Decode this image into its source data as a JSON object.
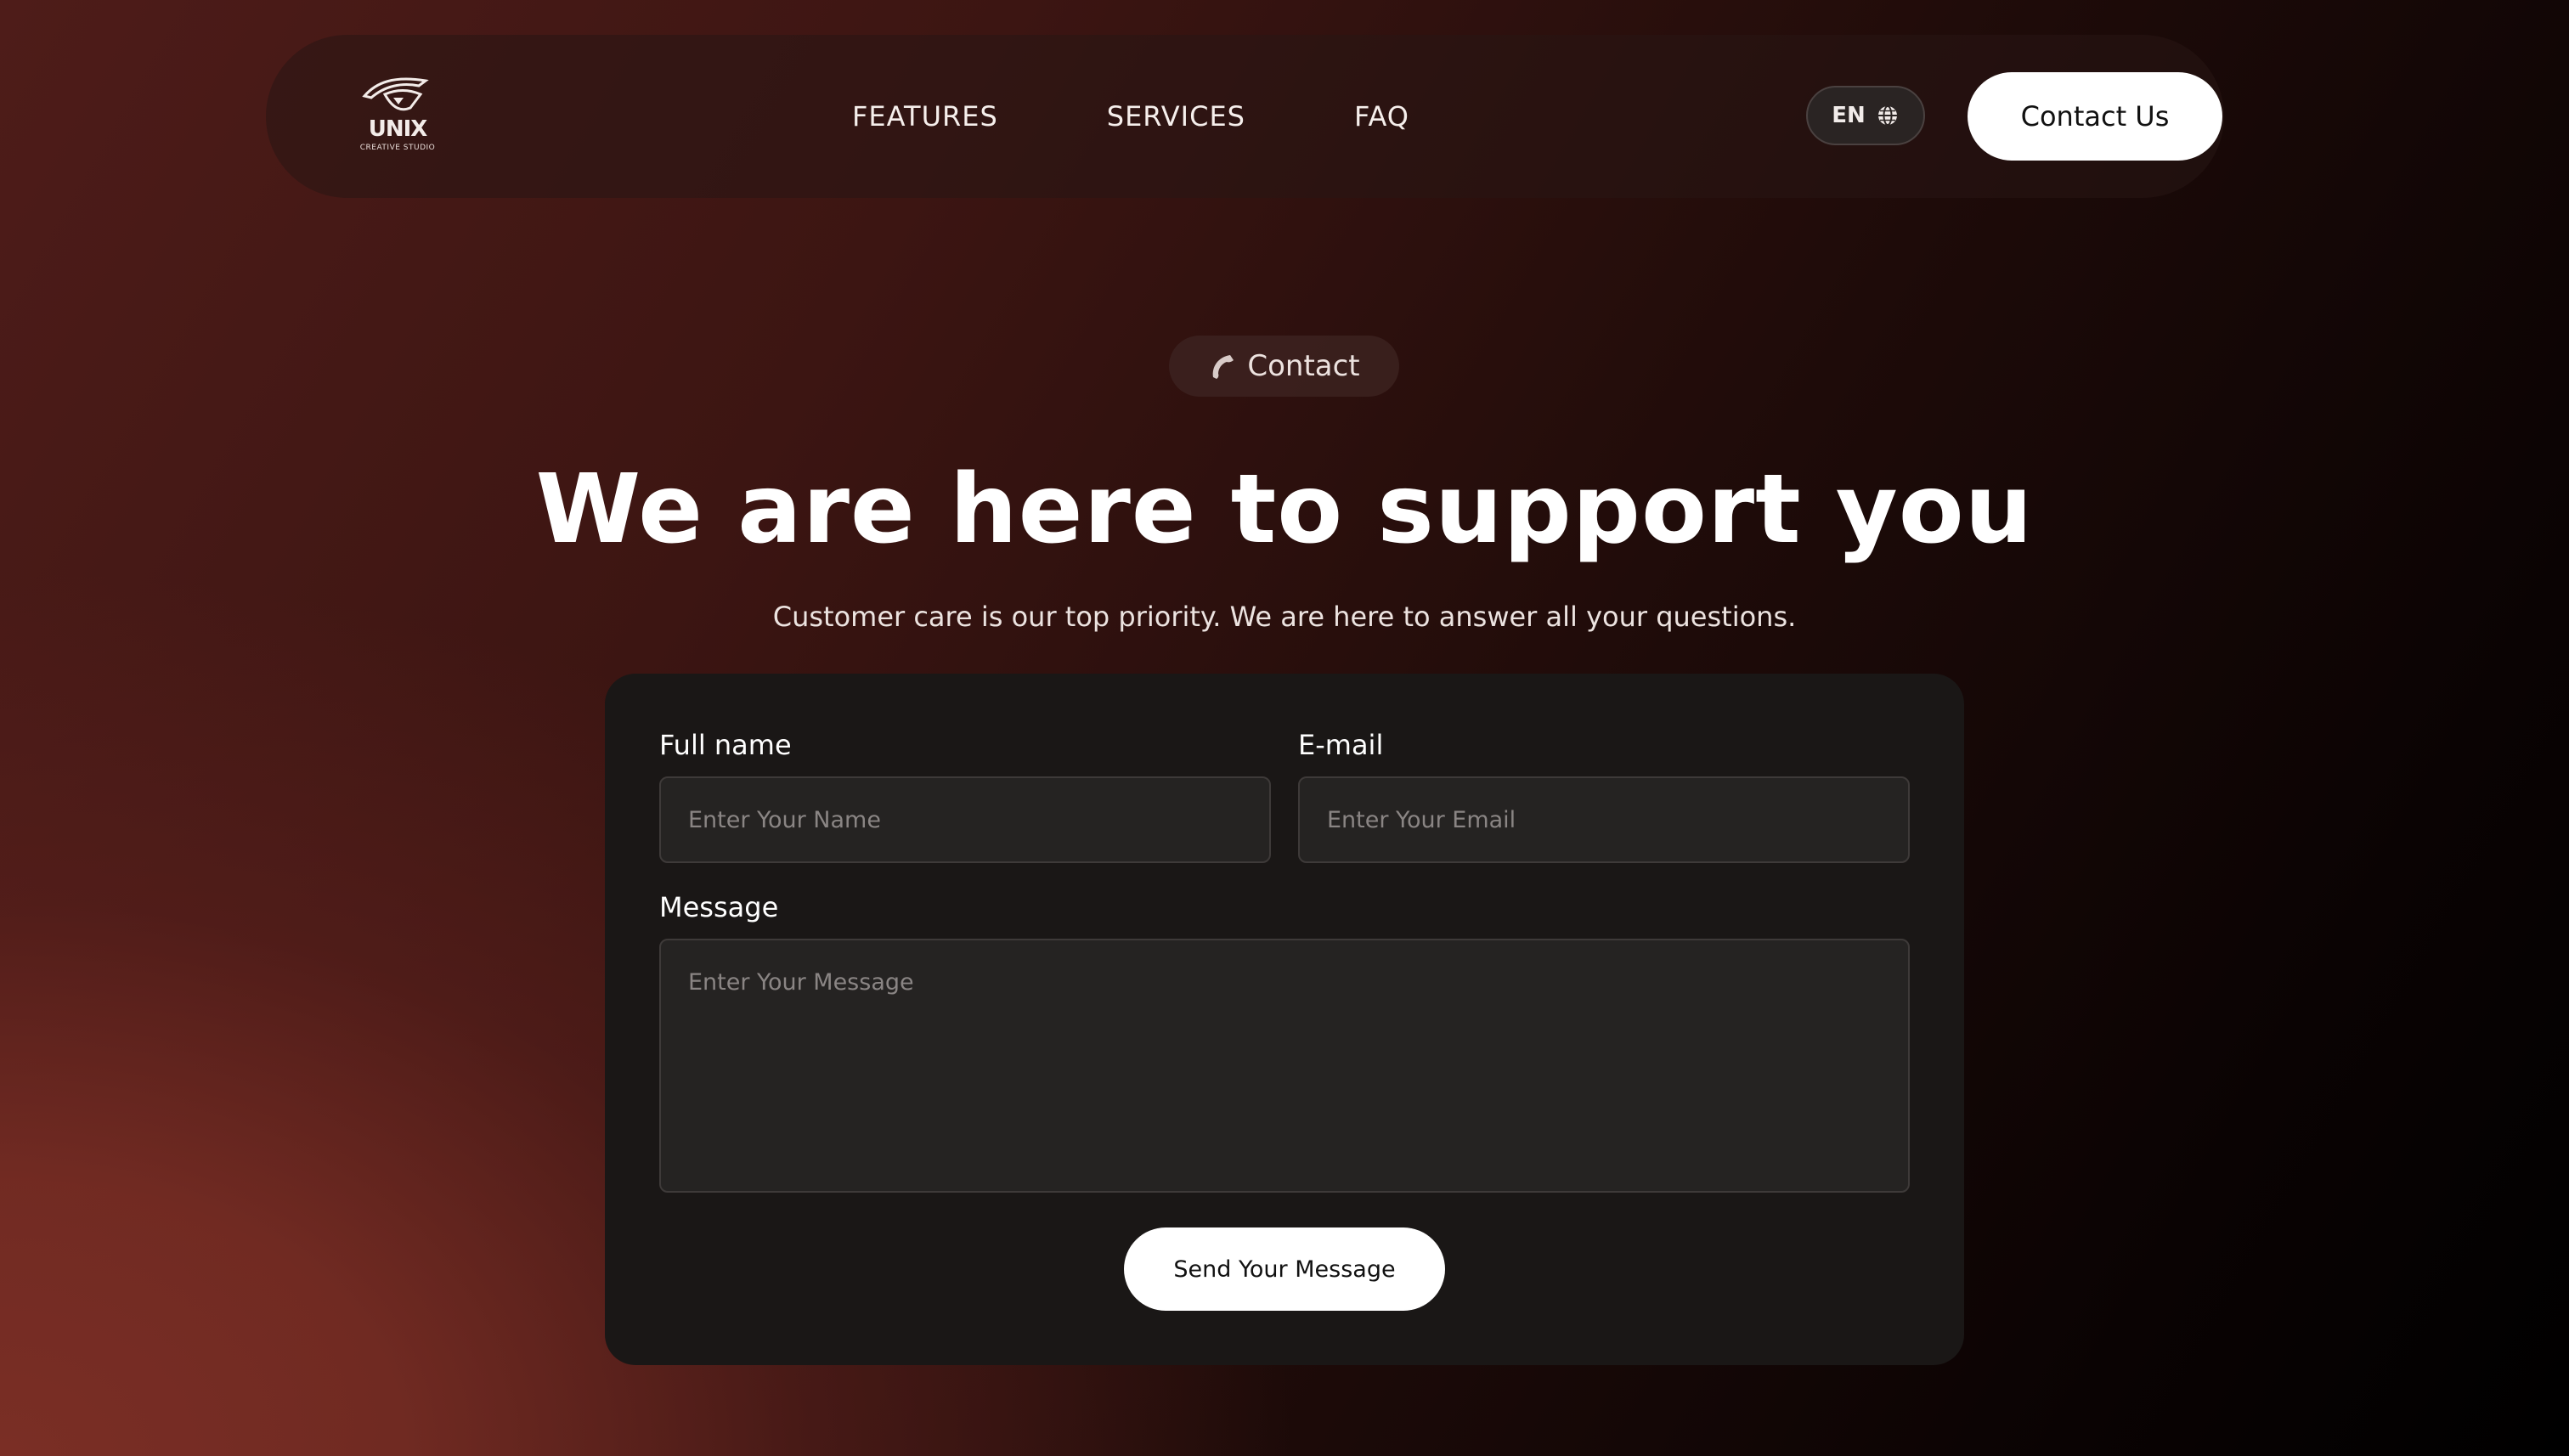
{
  "header": {
    "logo": {
      "wordmark": "UNIX",
      "tagline": "CREATIVE STUDIO"
    },
    "nav": [
      {
        "label": "FEATURES"
      },
      {
        "label": "SERVICES"
      },
      {
        "label": "FAQ"
      }
    ],
    "language": {
      "label": "EN",
      "icon": "globe-icon"
    },
    "contact_button": {
      "label": "Contact Us"
    }
  },
  "hero": {
    "pill": {
      "icon": "phone-icon",
      "label": "Contact"
    },
    "title": "We are here to support you",
    "subtitle": "Customer care is our top priority. We are here to answer all your questions."
  },
  "form": {
    "full_name": {
      "label": "Full name",
      "placeholder": "Enter Your Name",
      "value": ""
    },
    "email": {
      "label": "E-mail",
      "placeholder": "Enter Your Email",
      "value": ""
    },
    "message": {
      "label": "Message",
      "placeholder": "Enter Your Message",
      "value": ""
    },
    "submit": {
      "label": "Send Your Message"
    }
  },
  "colors": {
    "background_accent": "#7a2e25",
    "background_dark": "#000000",
    "card": "#1a1716",
    "input_bg": "#252322",
    "button": "#ffffff"
  }
}
